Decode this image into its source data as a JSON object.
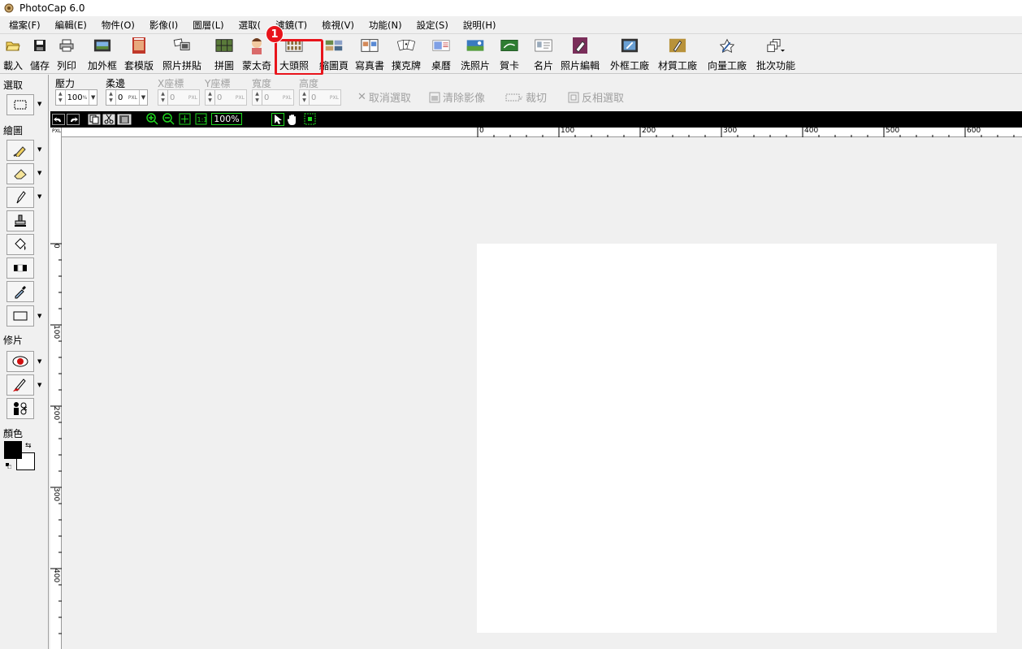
{
  "window": {
    "title": "PhotoCap 6.0"
  },
  "menu": [
    "檔案(F)",
    "編輯(E)",
    "物件(O)",
    "影像(I)",
    "圖層(L)",
    "選取(",
    "濾鏡(T)",
    "檢視(V)",
    "功能(N)",
    "設定(S)",
    "說明(H)"
  ],
  "toolbar": [
    {
      "label": "載入",
      "icon": "open-folder-icon"
    },
    {
      "label": "儲存",
      "icon": "save-disk-icon"
    },
    {
      "label": "列印",
      "icon": "printer-icon"
    },
    {
      "label": "加外框",
      "icon": "frame-icon"
    },
    {
      "label": "套模版",
      "icon": "template-icon"
    },
    {
      "label": "照片拼貼",
      "icon": "photo-collage-icon"
    },
    {
      "label": "拼圖",
      "icon": "puzzle-icon"
    },
    {
      "label": "蒙太奇",
      "icon": "montage-icon"
    },
    {
      "label": "大頭照",
      "icon": "id-photo-icon"
    },
    {
      "label": "縮圖頁",
      "icon": "thumbnail-page-icon"
    },
    {
      "label": "寫真書",
      "icon": "photo-book-icon"
    },
    {
      "label": "撲克牌",
      "icon": "poker-card-icon"
    },
    {
      "label": "桌曆",
      "icon": "desk-calendar-icon"
    },
    {
      "label": "洗照片",
      "icon": "print-photo-icon"
    },
    {
      "label": "賀卡",
      "icon": "greeting-card-icon"
    },
    {
      "label": "名片",
      "icon": "business-card-icon"
    },
    {
      "label": "照片編輯",
      "icon": "photo-edit-icon"
    },
    {
      "label": "外框工廠",
      "icon": "frame-factory-icon"
    },
    {
      "label": "材質工廠",
      "icon": "texture-factory-icon"
    },
    {
      "label": "向量工廠",
      "icon": "vector-factory-icon"
    },
    {
      "label": "批次功能",
      "icon": "batch-icon"
    }
  ],
  "annotation": {
    "step": "1"
  },
  "options": {
    "pressure": {
      "label": "壓力",
      "value": "100",
      "unit": "%"
    },
    "feather": {
      "label": "柔邊",
      "value": "0",
      "unit": "PXL"
    },
    "x": {
      "label": "X座標",
      "value": "0",
      "unit": "PXL"
    },
    "y": {
      "label": "Y座標",
      "value": "0",
      "unit": "PXL"
    },
    "width": {
      "label": "寬度",
      "value": "0",
      "unit": "PXL"
    },
    "height": {
      "label": "高度",
      "value": "0",
      "unit": "PXL"
    },
    "cancel_selection": "取消選取",
    "clear_image": "清除影像",
    "crop": "裁切",
    "invert_selection": "反相選取"
  },
  "left_panel": {
    "select_label": "選取",
    "paint_label": "繪圖",
    "retouch_label": "修片",
    "color_label": "顏色"
  },
  "canvas": {
    "zoom": "100%",
    "ruler_unit": "PXL",
    "h_ticks": [
      "0",
      "100",
      "200",
      "300",
      "400",
      "500",
      "600"
    ],
    "v_ticks": [
      "0",
      "100",
      "200",
      "300",
      "400"
    ]
  }
}
